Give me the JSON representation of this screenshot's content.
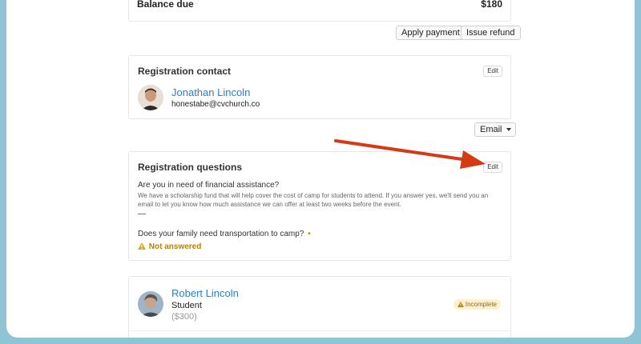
{
  "balance": {
    "label": "Balance due",
    "amount": "$180"
  },
  "actions": {
    "apply_payment": "Apply payment",
    "issue_refund": "Issue refund"
  },
  "contact": {
    "title": "Registration contact",
    "edit": "Edit",
    "name": "Jonathan Lincoln",
    "email": "honestabe@cvchurch.co"
  },
  "email_button": {
    "label": "Email",
    "icon": "caret-down-icon"
  },
  "questions": {
    "title": "Registration questions",
    "edit": "Edit",
    "q1": {
      "question": "Are you in need of financial assistance?",
      "help": "We have a scholarship fund that will help cover the cost of camp for students to attend. If you answer yes, we'll send you an email to let you know how much assistance we can offer at least two weeks before the event.",
      "answer": "—"
    },
    "q2": {
      "question": "Does your family need transportation to camp?",
      "required_marker": "•",
      "status": "Not answered",
      "status_icon": "warning-icon"
    }
  },
  "attendee": {
    "name": "Robert Lincoln",
    "role": "Student",
    "amount": "($300)",
    "badge": "Incomplete",
    "badge_icon": "warning-icon"
  },
  "colors": {
    "link": "#2d7fc1",
    "arrow": "#d63a14",
    "warning": "#b98200",
    "badge_bg": "#fcefd2",
    "frame": "#8fc4d4"
  }
}
